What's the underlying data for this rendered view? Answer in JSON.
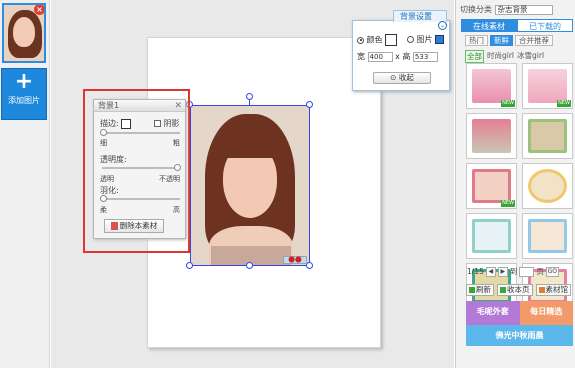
{
  "photo_panel": {
    "add_label": "添加图片"
  },
  "float_panel": {
    "title": "背景1",
    "border_label": "描边:",
    "shadow_label": "阴影",
    "thin": "细",
    "thick": "粗",
    "opacity_label": "透明度:",
    "opaque": "透明",
    "not_opaque": "不透明",
    "feather_label": "羽化:",
    "soft": "柔",
    "hard": "高",
    "delete_label": "删除本素材"
  },
  "bg_settings": {
    "title": "背景设置",
    "color_label": "颜色",
    "image_label": "图片",
    "width_label": "宽",
    "width_value": "400",
    "times": "x",
    "height_label": "高",
    "height_value": "533",
    "collapse_label": "收起"
  },
  "right_panel": {
    "category_label": "切换分类",
    "category_value": "杂志背景",
    "tabs": [
      "在线素材",
      "已下载的"
    ],
    "subtabs": [
      "热门",
      "新鲜",
      "合并推荐"
    ],
    "filters": [
      "全部",
      "时尚girl",
      "冰雪girl"
    ],
    "pager_page": "1/15",
    "pager_goto": "到",
    "pager_unit": "页",
    "pager_go": "GO",
    "actions": [
      "刷新",
      "收本页",
      "素材馆"
    ],
    "promos": [
      "毛呢外套",
      "每日精选",
      "佛光中秋雨晨"
    ]
  },
  "colors": {
    "accent": "#2f8de0",
    "frame_red": "#e03333",
    "selection": "#3346e6"
  }
}
